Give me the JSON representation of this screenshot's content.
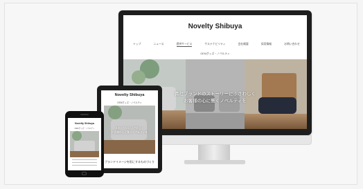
{
  "site": {
    "title": "Novelty Shibuya",
    "nav": [
      "トップ",
      "ニュース",
      "提供サービス",
      "サステナビリティ",
      "会社概要",
      "採用情報",
      "お問い合わせ"
    ],
    "active_nav_index": 2,
    "sub_label": "OEMグッズ・ノベルティ",
    "hero_line1": "貴社ブランドのストーリーにふさわしく",
    "hero_line2": "お客様の心に響くノベルティを",
    "tablet_footer": "ブランドイメージを形にするものづくり"
  },
  "tablet": {
    "title": "Novelty Shibuya",
    "sub_label": "OEMグッズ・ノベルティ",
    "hero_line1": "ストーリーにふさわしく",
    "hero_line2": "お客様の心に響くノベルティを"
  },
  "phone": {
    "title": "Novelty Shibuya",
    "sub_label": "OEMグッズ・ノベルティ"
  },
  "colors": {
    "background": "#f7f7f7",
    "device_frame": "#1e1e1e",
    "text": "#222222"
  }
}
